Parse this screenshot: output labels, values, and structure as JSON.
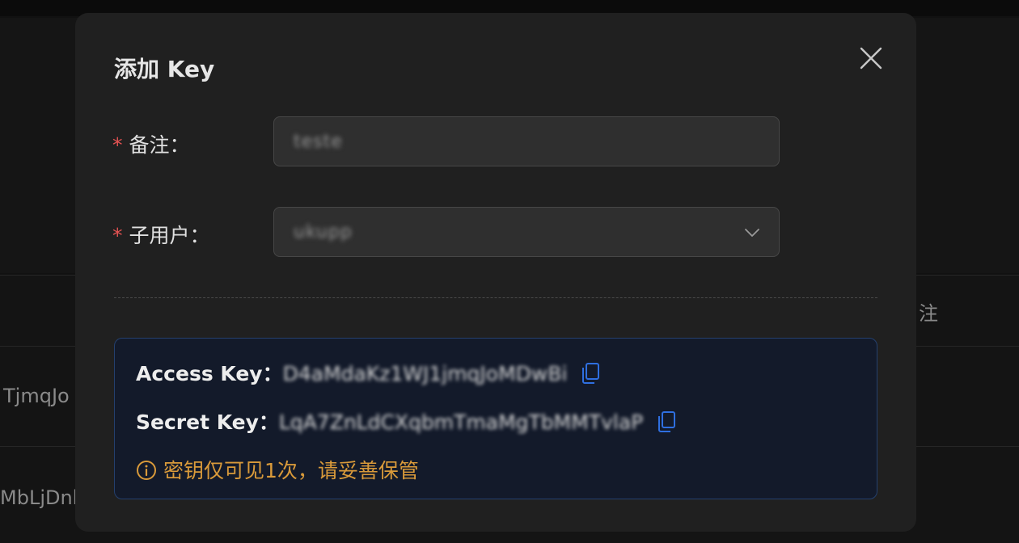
{
  "background": {
    "table_header_partial": "注",
    "row_values": [
      "TjmqJo",
      "MbLjDnl"
    ]
  },
  "modal": {
    "title": "添加 Key",
    "fields": {
      "remark": {
        "required_mark": "*",
        "label": "备注：",
        "value": "teste"
      },
      "sub_user": {
        "required_mark": "*",
        "label": "子用户：",
        "value": "ukupp"
      }
    },
    "keys": {
      "access_key_label": "Access Key：",
      "access_key_value": "D4aMdaKz1WJ1jmqJoMDwBi",
      "secret_key_label": "Secret Key：",
      "secret_key_value": "LqA7ZnLdCXqbmTmaMgTbMMTvlaP"
    },
    "warning": "密钥仅可见1次，请妥善保管",
    "colors": {
      "accent_blue": "#2f6fe0",
      "warning_orange": "#d99a3a",
      "required_red": "#e55353"
    }
  }
}
